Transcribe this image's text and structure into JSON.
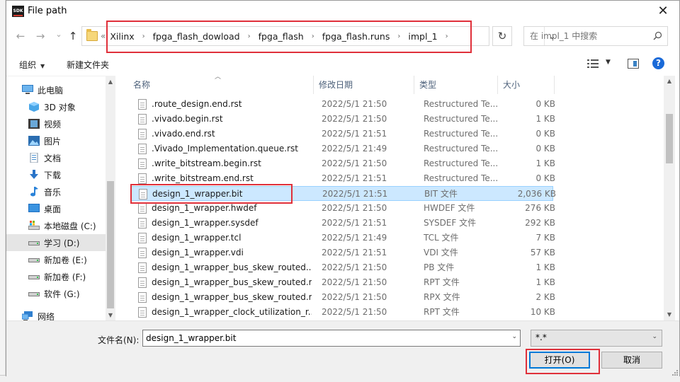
{
  "window": {
    "title": "File path",
    "app_icon_text": "SDK"
  },
  "nav": {
    "back": "←",
    "forward": "→",
    "dropdown": "⌄",
    "up": "↑",
    "breadcrumb_lead": "«",
    "breadcrumb": [
      "Xilinx",
      "fpga_flash_dowload",
      "fpga_flash",
      "fpga_flash.runs",
      "impl_1"
    ],
    "search_placeholder": "在 impl_1 中搜索"
  },
  "toolbar": {
    "organize": "组织",
    "new_folder": "新建文件夹"
  },
  "sidebar": {
    "items": [
      {
        "label": "此电脑",
        "icon": "computer-icon"
      },
      {
        "label": "3D 对象",
        "icon": "cube-icon"
      },
      {
        "label": "视频",
        "icon": "video-icon"
      },
      {
        "label": "图片",
        "icon": "picture-icon"
      },
      {
        "label": "文档",
        "icon": "document-icon"
      },
      {
        "label": "下载",
        "icon": "download-icon"
      },
      {
        "label": "音乐",
        "icon": "music-icon"
      },
      {
        "label": "桌面",
        "icon": "desktop-icon"
      },
      {
        "label": "本地磁盘 (C:)",
        "icon": "drive-c-icon"
      },
      {
        "label": "学习 (D:)",
        "icon": "drive-icon",
        "selected": true
      },
      {
        "label": "新加卷 (E:)",
        "icon": "drive-icon"
      },
      {
        "label": "新加卷 (F:)",
        "icon": "drive-icon"
      },
      {
        "label": "软件 (G:)",
        "icon": "drive-icon"
      },
      {
        "label": "网络",
        "icon": "network-icon"
      }
    ]
  },
  "columns": {
    "name": "名称",
    "date": "修改日期",
    "type": "类型",
    "size": "大小"
  },
  "files": [
    {
      "name": ".route_design.end.rst",
      "date": "2022/5/1 21:50",
      "type": "Restructured Te...",
      "size": "0 KB"
    },
    {
      "name": ".vivado.begin.rst",
      "date": "2022/5/1 21:50",
      "type": "Restructured Te...",
      "size": "1 KB"
    },
    {
      "name": ".vivado.end.rst",
      "date": "2022/5/1 21:51",
      "type": "Restructured Te...",
      "size": "0 KB"
    },
    {
      "name": ".Vivado_Implementation.queue.rst",
      "date": "2022/5/1 21:49",
      "type": "Restructured Te...",
      "size": "0 KB"
    },
    {
      "name": ".write_bitstream.begin.rst",
      "date": "2022/5/1 21:50",
      "type": "Restructured Te...",
      "size": "1 KB"
    },
    {
      "name": ".write_bitstream.end.rst",
      "date": "2022/5/1 21:51",
      "type": "Restructured Te...",
      "size": "0 KB"
    },
    {
      "name": "design_1_wrapper.bit",
      "date": "2022/5/1 21:51",
      "type": "BIT 文件",
      "size": "2,036 KB",
      "selected": true
    },
    {
      "name": "design_1_wrapper.hwdef",
      "date": "2022/5/1 21:50",
      "type": "HWDEF 文件",
      "size": "276 KB"
    },
    {
      "name": "design_1_wrapper.sysdef",
      "date": "2022/5/1 21:51",
      "type": "SYSDEF 文件",
      "size": "292 KB"
    },
    {
      "name": "design_1_wrapper.tcl",
      "date": "2022/5/1 21:49",
      "type": "TCL 文件",
      "size": "7 KB"
    },
    {
      "name": "design_1_wrapper.vdi",
      "date": "2022/5/1 21:51",
      "type": "VDI 文件",
      "size": "57 KB"
    },
    {
      "name": "design_1_wrapper_bus_skew_routed....",
      "date": "2022/5/1 21:50",
      "type": "PB 文件",
      "size": "1 KB"
    },
    {
      "name": "design_1_wrapper_bus_skew_routed.r...",
      "date": "2022/5/1 21:50",
      "type": "RPT 文件",
      "size": "1 KB"
    },
    {
      "name": "design_1_wrapper_bus_skew_routed.r...",
      "date": "2022/5/1 21:50",
      "type": "RPX 文件",
      "size": "2 KB"
    },
    {
      "name": "design_1_wrapper_clock_utilization_r...",
      "date": "2022/5/1 21:50",
      "type": "RPT 文件",
      "size": "10 KB"
    }
  ],
  "footer": {
    "filename_label": "文件名(N):",
    "filename_value": "design_1_wrapper.bit",
    "filter_value": "*.*",
    "open_button": "打开(O)",
    "cancel_button": "取消"
  },
  "colors": {
    "highlight": "#e0303a",
    "selection": "#cce8ff",
    "accent": "#0078d7"
  }
}
